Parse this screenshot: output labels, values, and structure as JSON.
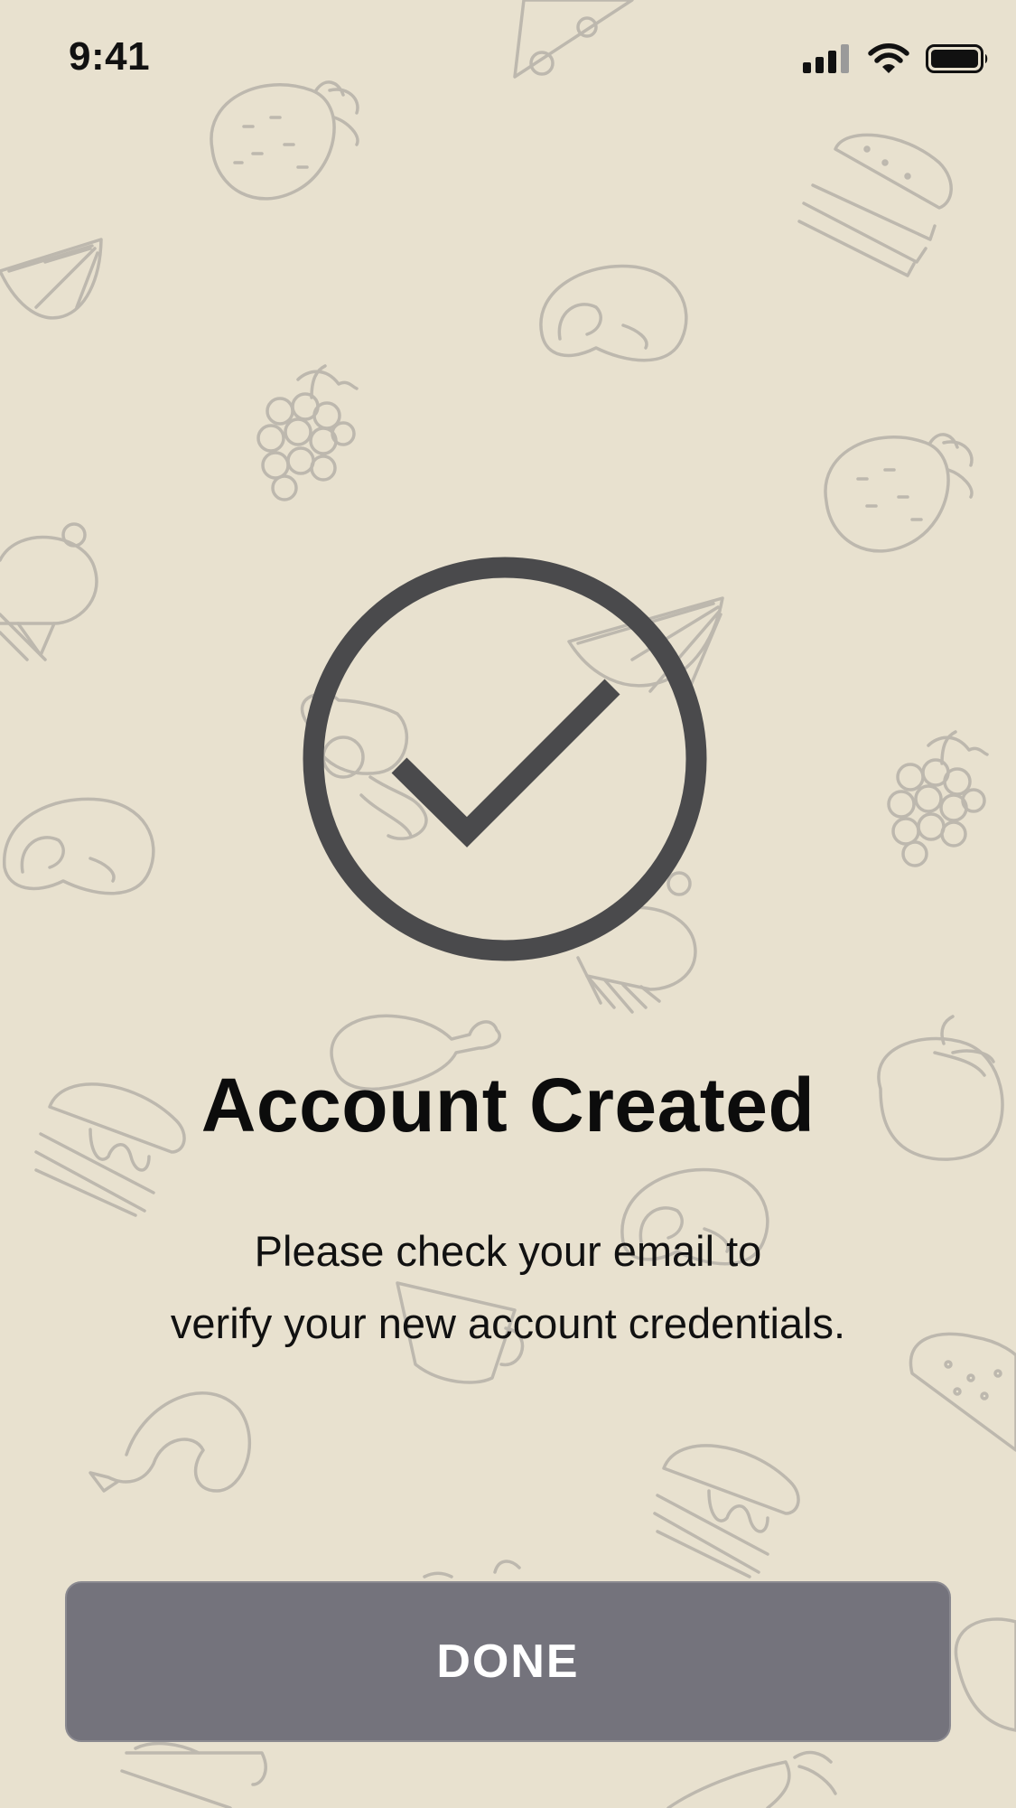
{
  "status_bar": {
    "time": "9:41",
    "icons": [
      "cellular-signal-icon",
      "wifi-icon",
      "battery-icon"
    ]
  },
  "background": {
    "pattern": "food-doodles",
    "icons": [
      "pizza-slice-icon",
      "strawberry-icon",
      "burger-icon",
      "lemon-slice-icon",
      "steak-icon",
      "grapes-icon",
      "cupcake-icon",
      "egg-bacon-icon",
      "drumstick-icon",
      "pancakes-icon",
      "tomato-icon",
      "coffee-mug-icon",
      "taco-icon",
      "shrimp-icon",
      "carrot-icon",
      "sandwich-icon"
    ],
    "color": "#e8e1cf",
    "doodle_color": "#bdb8ae"
  },
  "success": {
    "icon": "check-circle-icon",
    "color": "#4a4a4c"
  },
  "title": "Account Created",
  "message": {
    "line1": "Please check your email to",
    "line2": "verify your new account credentials."
  },
  "done_button": {
    "label": "DONE",
    "color": "#74737c"
  }
}
